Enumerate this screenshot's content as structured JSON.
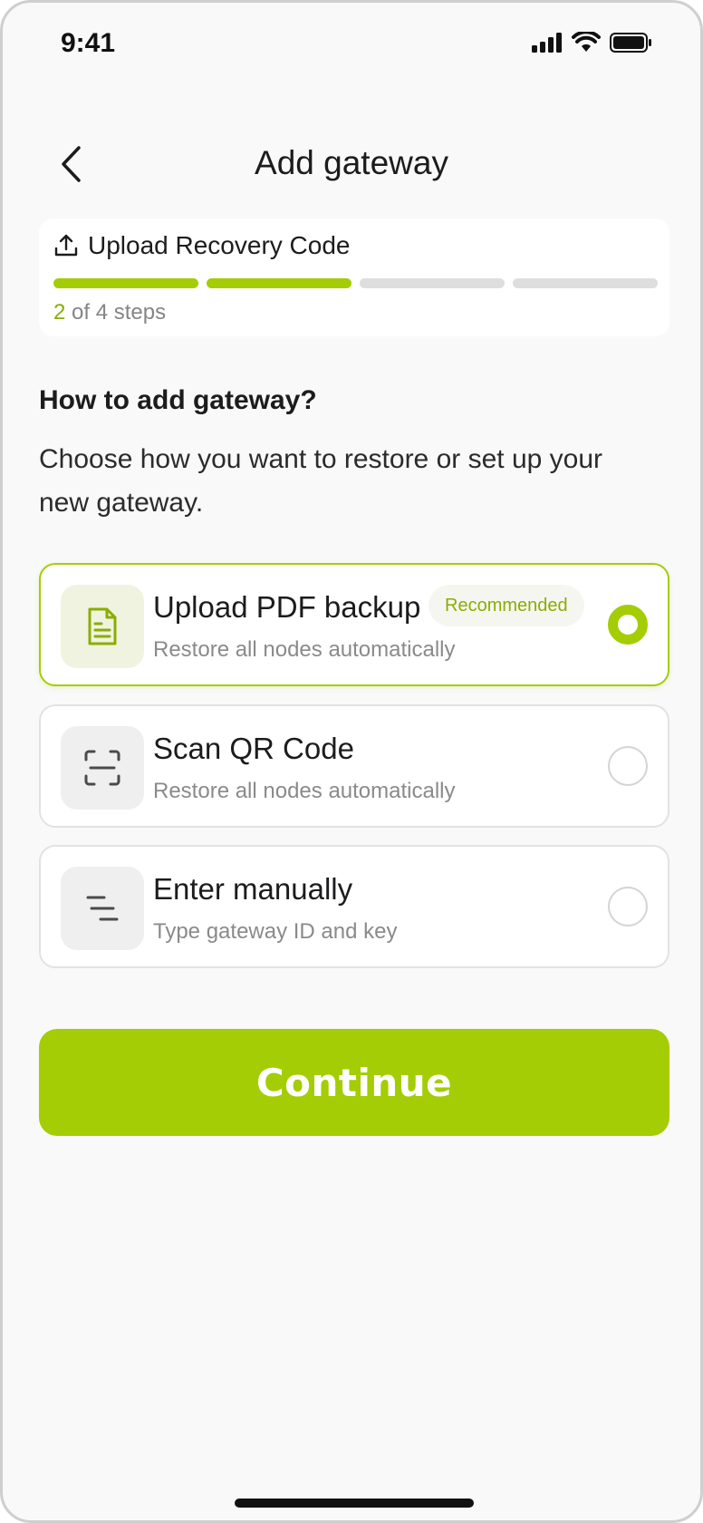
{
  "status_bar": {
    "time": "9:41"
  },
  "header": {
    "title": "Add gateway"
  },
  "progress": {
    "title": "Upload Recovery Code",
    "current_step": "2",
    "steps_suffix": "of 4 steps",
    "completed_fraction": 0.5
  },
  "prompt": {
    "heading": "How to add gateway?",
    "description": "Choose how you want to restore or set up your new gateway."
  },
  "options": [
    {
      "title": "Upload PDF backup",
      "subtitle": "Restore all nodes automatically",
      "badge": "Recommended",
      "selected": true,
      "icon": "document-icon"
    },
    {
      "title": "Scan QR Code",
      "subtitle": "Restore all nodes automatically",
      "selected": false,
      "icon": "scan-icon"
    },
    {
      "title": "Enter manually",
      "subtitle": "Type gateway ID and key",
      "selected": false,
      "icon": "text-lines-icon"
    }
  ],
  "actions": {
    "continue_label": "Continue"
  },
  "colors": {
    "accent": "#a4cd05",
    "accent_text": "#8aad05",
    "background": "#f9f9f9"
  }
}
